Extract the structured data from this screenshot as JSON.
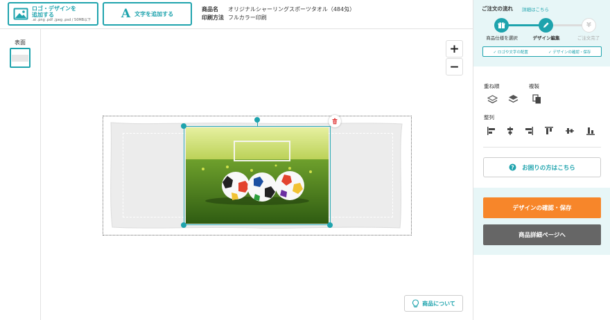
{
  "toolbar": {
    "add_logo_label_line1": "ロゴ・デザインを",
    "add_logo_label_line2": "追加する",
    "add_logo_sub": ".ai .png .pdf .jpeg .psd / 50MB以下",
    "add_text_icon": "A",
    "add_text_label": "文字を追加する"
  },
  "product": {
    "name_key": "商品名",
    "name_value": "オリジナルシャーリングスポーツタオル（484匁）",
    "print_key": "印刷方法",
    "print_value": "フルカラー印刷"
  },
  "sides": {
    "label": "表面"
  },
  "zoom": {
    "plus": "+",
    "minus": "−"
  },
  "about_button": "商品について",
  "flow": {
    "title": "ご注文の流れ",
    "help_link": "詳細はこちら",
    "steps": [
      {
        "label": "商品仕様を選択",
        "icon": "gift-icon",
        "state": "done"
      },
      {
        "label": "デザイン編集",
        "icon": "pencil-icon",
        "state": "current"
      },
      {
        "label": "ご注文完了",
        "icon": "yen-icon",
        "state": "todo"
      }
    ],
    "substeps": [
      "✓ ロゴや文字の配置",
      "✓ デザインの確認・保存"
    ]
  },
  "tools": {
    "layer_label": "重ね順",
    "duplicate_label": "複製",
    "align_label": "整列"
  },
  "help_button": "お困りの方はこちら",
  "actions": {
    "confirm_save": "デザインの確認・保存",
    "product_detail": "商品詳細ページへ"
  },
  "colors": {
    "accent": "#1ea3ad",
    "orange": "#f7862a",
    "gray_button": "#666666",
    "panel_bg": "#e7f6f7"
  }
}
